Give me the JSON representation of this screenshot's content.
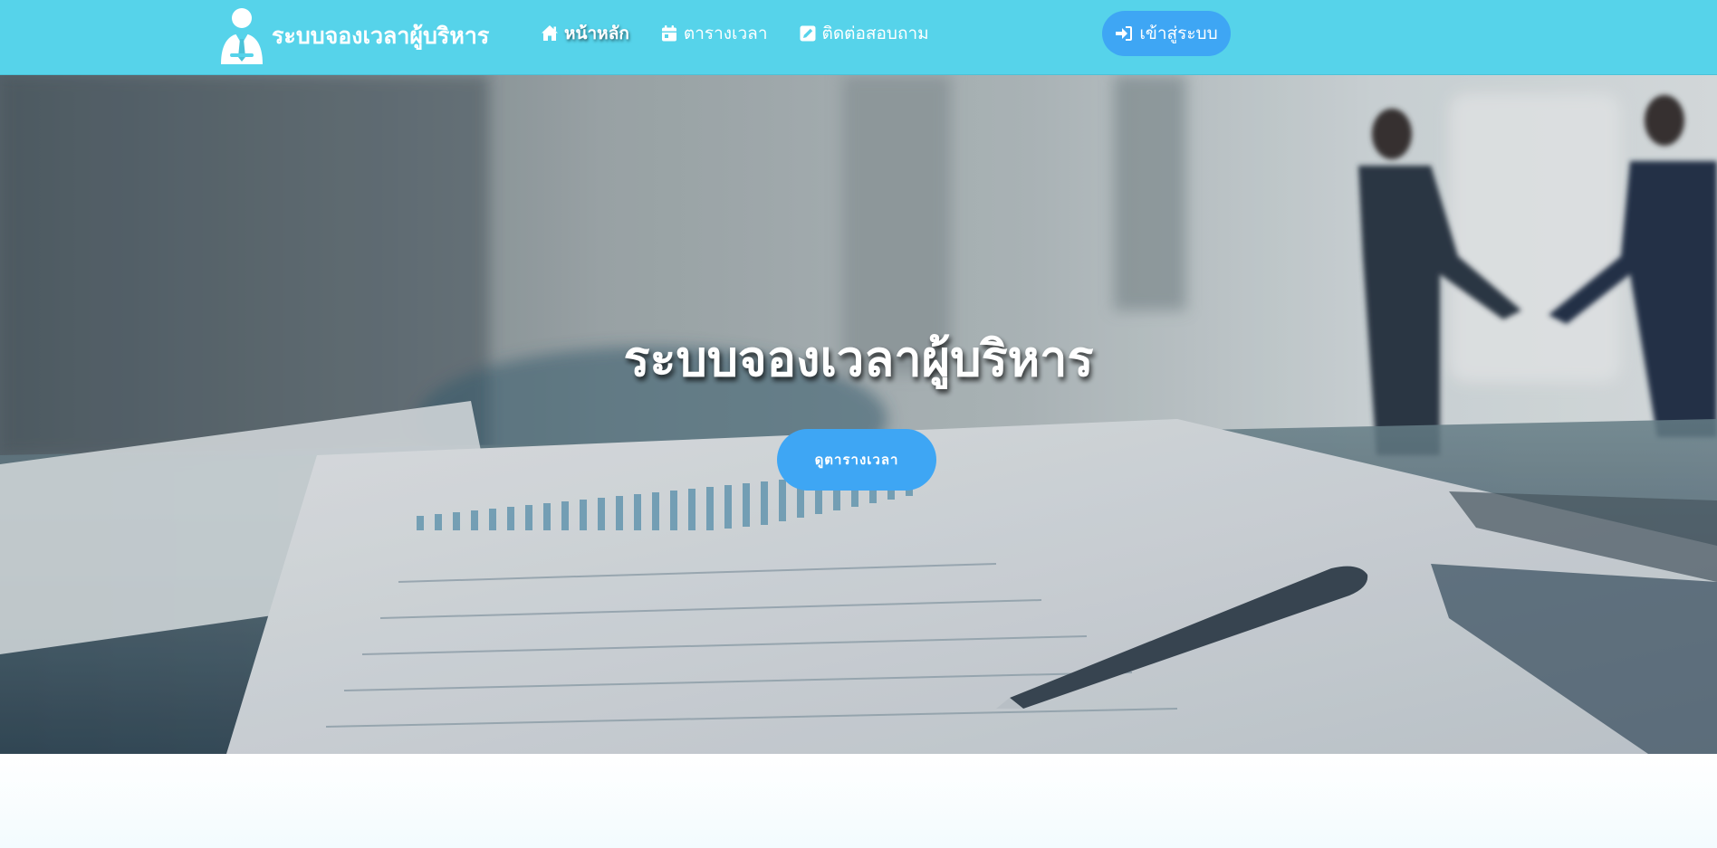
{
  "brand": {
    "name": "ระบบจองเวลาผู้บริหาร",
    "logo_icon": "executive-person-icon"
  },
  "nav": {
    "items": [
      {
        "label": "หน้าหลัก",
        "icon": "home-icon",
        "active": true
      },
      {
        "label": "ตารางเวลา",
        "icon": "calendar-icon",
        "active": false
      },
      {
        "label": "ติดต่อสอบถาม",
        "icon": "contact-edit-icon",
        "active": false
      }
    ],
    "login": {
      "label": "เข้าสู่ระบบ",
      "icon": "sign-in-icon"
    }
  },
  "hero": {
    "title": "ระบบจองเวลาผู้บริหาร",
    "button_label": "ดูตารางเวลา"
  },
  "colors": {
    "navbar_bg": "#56d3ea",
    "accent_button": "#3ea6f4",
    "text_light": "#ffffff"
  }
}
